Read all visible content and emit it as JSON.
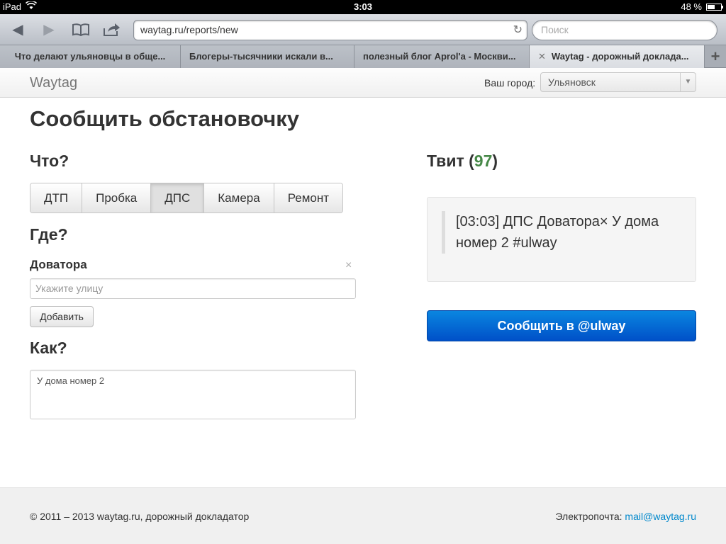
{
  "status_bar": {
    "device": "iPad",
    "time": "3:03",
    "battery": "48 %",
    "battery_level": 0.48
  },
  "browser": {
    "url": "waytag.ru/reports/new",
    "search_placeholder": "Поиск",
    "tabs": [
      {
        "title": "Что делают ульяновцы в обще..."
      },
      {
        "title": "Блогеры-тысячники искали в..."
      },
      {
        "title": "полезный блог Aprol'а - Москви..."
      },
      {
        "title": "Waytag - дорожный доклада...",
        "active": true
      }
    ]
  },
  "navbar": {
    "brand": "Waytag",
    "city_label": "Ваш город:",
    "city_value": "Ульяновск"
  },
  "page": {
    "title": "Сообщить обстановочку",
    "what_heading": "Что?",
    "what_options": [
      {
        "label": "ДТП"
      },
      {
        "label": "Пробка"
      },
      {
        "label": "ДПС",
        "active": true
      },
      {
        "label": "Камера"
      },
      {
        "label": "Ремонт"
      }
    ],
    "where_heading": "Где?",
    "street_name": "Доватора",
    "street_remove": "×",
    "street_placeholder": "Укажите улицу",
    "add_button": "Добавить",
    "how_heading": "Как?",
    "how_text": "У дома номер 2",
    "tweet_heading": "Твит",
    "tweet_count": "97",
    "tweet_text": "[03:03] ДПС Доватора× У дома номер 2 #ulway",
    "submit_button": "Сообщить в @ulway"
  },
  "footer": {
    "copyright": "© 2011 – 2013 waytag.ru, дорожный докладатор",
    "email_label": "Электропочта:",
    "email": "mail@waytag.ru"
  }
}
